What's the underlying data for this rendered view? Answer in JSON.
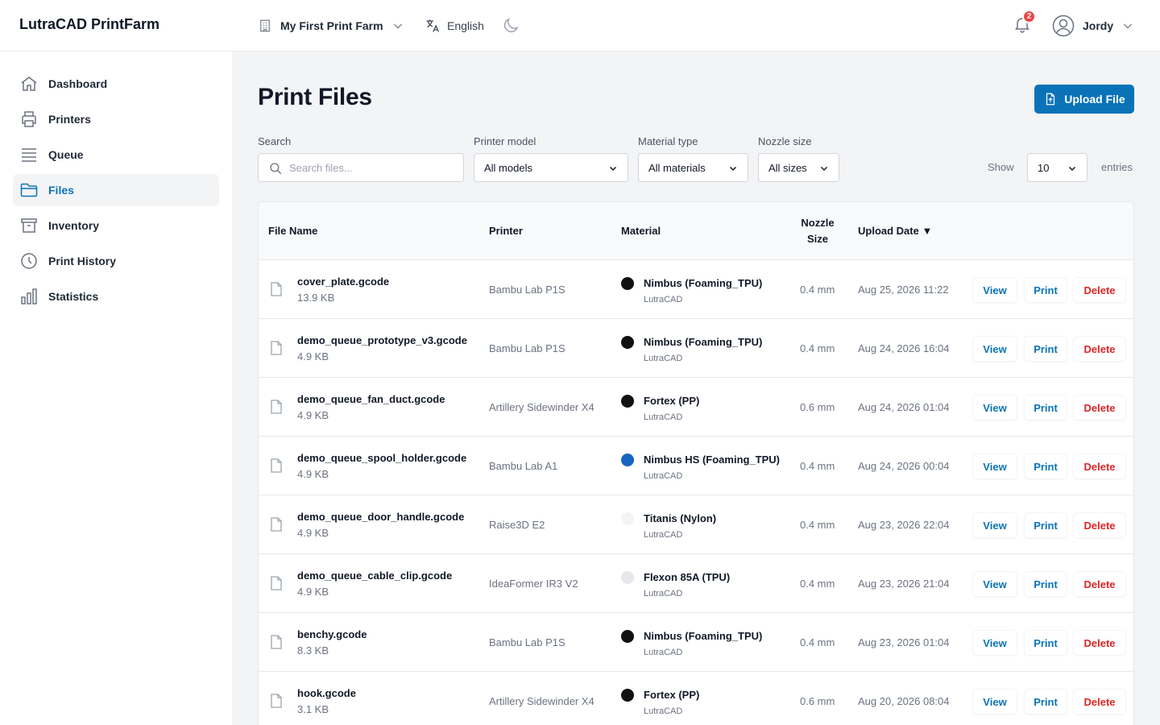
{
  "app": {
    "title": "LutraCAD PrintFarm"
  },
  "topbar": {
    "farm": "My First Print Farm",
    "language": "English",
    "notifications_count": "2",
    "user": "Jordy"
  },
  "sidebar": {
    "items": [
      {
        "label": "Dashboard",
        "icon": "home-icon"
      },
      {
        "label": "Printers",
        "icon": "printer-icon"
      },
      {
        "label": "Queue",
        "icon": "queue-icon"
      },
      {
        "label": "Files",
        "icon": "folder-icon",
        "active": true
      },
      {
        "label": "Inventory",
        "icon": "archive-icon"
      },
      {
        "label": "Print History",
        "icon": "clock-icon"
      },
      {
        "label": "Statistics",
        "icon": "bar-chart-icon"
      }
    ]
  },
  "main": {
    "title": "Print Files",
    "upload_label": "Upload File",
    "filters": {
      "search_label": "Search",
      "search_placeholder": "Search files...",
      "printer_label": "Printer model",
      "printer_value": "All models",
      "material_label": "Material type",
      "material_value": "All materials",
      "nozzle_label": "Nozzle size",
      "nozzle_value": "All sizes",
      "show_label": "Show",
      "show_value": "10",
      "entries_label": "entries"
    },
    "table": {
      "headers": {
        "file_name": "File Name",
        "printer": "Printer",
        "material": "Material",
        "nozzle_line1": "Nozzle",
        "nozzle_line2": "Size",
        "upload_date": "Upload Date ▼"
      },
      "actions": {
        "view": "View",
        "print": "Print",
        "delete": "Delete"
      },
      "rows": [
        {
          "name": "cover_plate.gcode",
          "size": "13.9 KB",
          "printer": "Bambu Lab P1S",
          "material": "Nimbus (Foaming_TPU)",
          "brand": "LutraCAD",
          "color": "#111111",
          "nozzle": "0.4 mm",
          "date": "Aug 25, 2026 11:22"
        },
        {
          "name": "demo_queue_prototype_v3.gcode",
          "size": "4.9 KB",
          "printer": "Bambu Lab P1S",
          "material": "Nimbus (Foaming_TPU)",
          "brand": "LutraCAD",
          "color": "#111111",
          "nozzle": "0.4 mm",
          "date": "Aug 24, 2026 16:04"
        },
        {
          "name": "demo_queue_fan_duct.gcode",
          "size": "4.9 KB",
          "printer": "Artillery Sidewinder X4",
          "material": "Fortex (PP)",
          "brand": "LutraCAD",
          "color": "#111111",
          "nozzle": "0.6 mm",
          "date": "Aug 24, 2026 01:04"
        },
        {
          "name": "demo_queue_spool_holder.gcode",
          "size": "4.9 KB",
          "printer": "Bambu Lab A1",
          "material": "Nimbus HS (Foaming_TPU)",
          "brand": "LutraCAD",
          "color": "#1565c0",
          "nozzle": "0.4 mm",
          "date": "Aug 24, 2026 00:04"
        },
        {
          "name": "demo_queue_door_handle.gcode",
          "size": "4.9 KB",
          "printer": "Raise3D E2",
          "material": "Titanis (Nylon)",
          "brand": "LutraCAD",
          "color": "#f3f4f6",
          "nozzle": "0.4 mm",
          "date": "Aug 23, 2026 22:04"
        },
        {
          "name": "demo_queue_cable_clip.gcode",
          "size": "4.9 KB",
          "printer": "IdeaFormer IR3 V2",
          "material": "Flexon 85A (TPU)",
          "brand": "LutraCAD",
          "color": "#e5e7eb",
          "nozzle": "0.4 mm",
          "date": "Aug 23, 2026 21:04"
        },
        {
          "name": "benchy.gcode",
          "size": "8.3 KB",
          "printer": "Bambu Lab P1S",
          "material": "Nimbus (Foaming_TPU)",
          "brand": "LutraCAD",
          "color": "#111111",
          "nozzle": "0.4 mm",
          "date": "Aug 23, 2026 01:04"
        },
        {
          "name": "hook.gcode",
          "size": "3.1 KB",
          "printer": "Artillery Sidewinder X4",
          "material": "Fortex (PP)",
          "brand": "LutraCAD",
          "color": "#111111",
          "nozzle": "0.6 mm",
          "date": "Aug 20, 2026 08:04"
        }
      ]
    }
  },
  "colors": {
    "accent": "#0a73b8",
    "danger": "#dc2626",
    "badge": "#ef4444"
  }
}
